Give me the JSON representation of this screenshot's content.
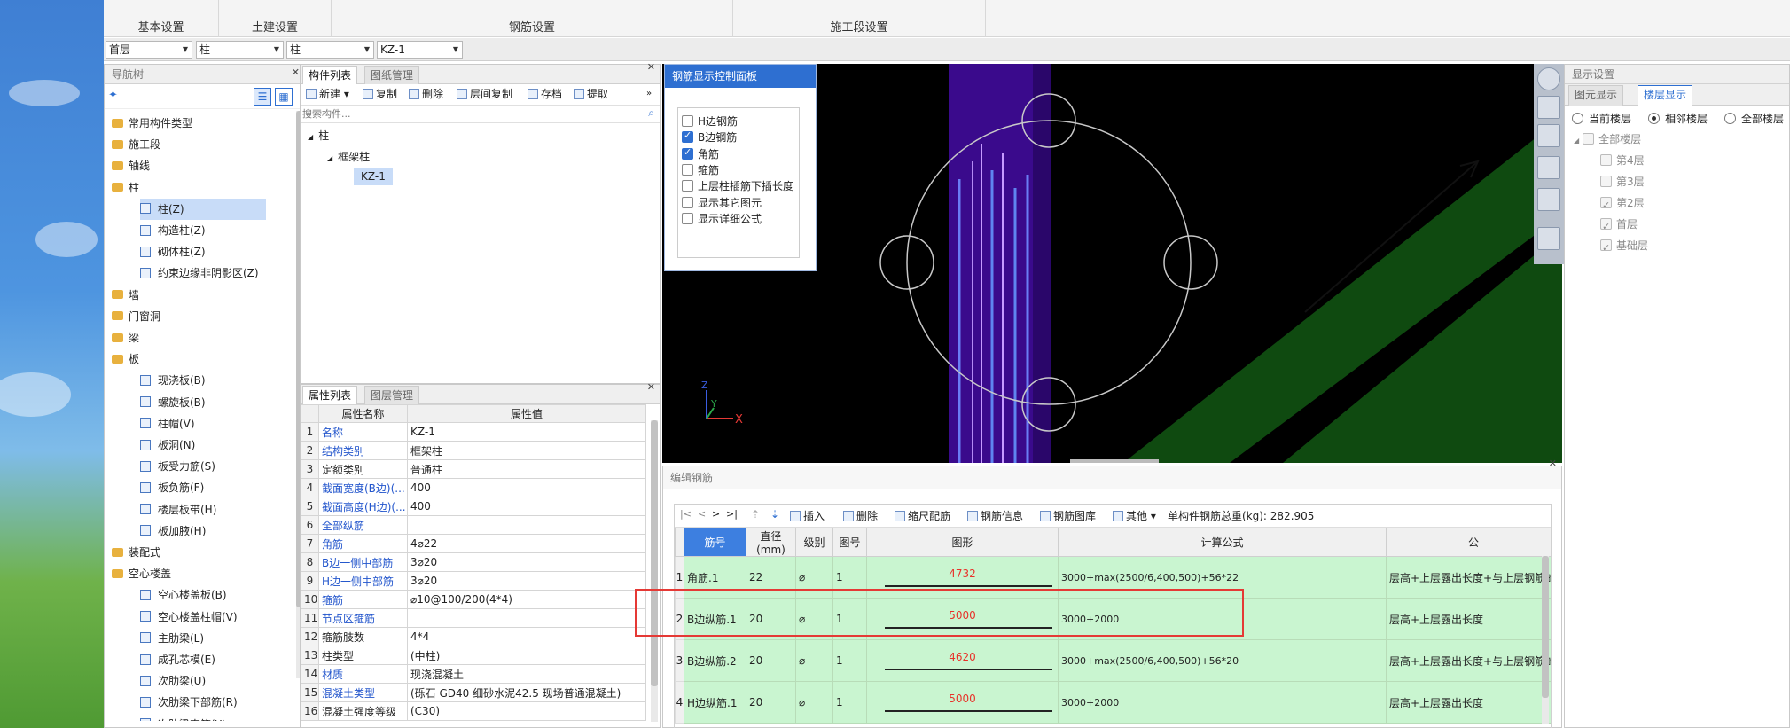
{
  "ribbon": {
    "groups": [
      "基本设置",
      "土建设置",
      "钢筋设置",
      "施工段设置"
    ]
  },
  "selectors": {
    "floor": "首层",
    "type1": "柱",
    "type2": "柱",
    "component": "KZ-1"
  },
  "nav": {
    "title": "导航树",
    "items": [
      {
        "label": "常用构件类型",
        "kind": "folder"
      },
      {
        "label": "施工段",
        "kind": "folder"
      },
      {
        "label": "轴线",
        "kind": "folder"
      },
      {
        "label": "柱",
        "kind": "folder"
      },
      {
        "label": "柱(Z)",
        "kind": "child",
        "selected": true
      },
      {
        "label": "构造柱(Z)",
        "kind": "child"
      },
      {
        "label": "砌体柱(Z)",
        "kind": "child"
      },
      {
        "label": "约束边缘非阴影区(Z)",
        "kind": "child"
      },
      {
        "label": "墙",
        "kind": "folder"
      },
      {
        "label": "门窗洞",
        "kind": "folder"
      },
      {
        "label": "梁",
        "kind": "folder"
      },
      {
        "label": "板",
        "kind": "folder"
      },
      {
        "label": "现浇板(B)",
        "kind": "child"
      },
      {
        "label": "螺旋板(B)",
        "kind": "child"
      },
      {
        "label": "柱帽(V)",
        "kind": "child"
      },
      {
        "label": "板洞(N)",
        "kind": "child"
      },
      {
        "label": "板受力筋(S)",
        "kind": "child"
      },
      {
        "label": "板负筋(F)",
        "kind": "child"
      },
      {
        "label": "楼层板带(H)",
        "kind": "child"
      },
      {
        "label": "板加腋(H)",
        "kind": "child"
      },
      {
        "label": "装配式",
        "kind": "folder"
      },
      {
        "label": "空心楼盖",
        "kind": "folder"
      },
      {
        "label": "空心楼盖板(B)",
        "kind": "child"
      },
      {
        "label": "空心楼盖柱帽(V)",
        "kind": "child"
      },
      {
        "label": "主肋梁(L)",
        "kind": "child"
      },
      {
        "label": "成孔芯模(E)",
        "kind": "child"
      },
      {
        "label": "次肋梁(U)",
        "kind": "child"
      },
      {
        "label": "次肋梁下部筋(R)",
        "kind": "child"
      },
      {
        "label": "次肋梁直筋(Y)",
        "kind": "child"
      }
    ]
  },
  "component_list": {
    "tabs": [
      "构件列表",
      "图纸管理"
    ],
    "toolbar": [
      "新建",
      "复制",
      "删除",
      "层间复制",
      "存档",
      "提取"
    ],
    "search_placeholder": "搜索构件...",
    "tree": [
      "柱",
      "框架柱",
      "KZ-1"
    ]
  },
  "properties": {
    "tabs": [
      "属性列表",
      "图层管理"
    ],
    "headers": [
      "属性名称",
      "属性值"
    ],
    "rows": [
      {
        "no": "1",
        "name": "名称",
        "value": "KZ-1"
      },
      {
        "no": "2",
        "name": "结构类别",
        "value": "框架柱"
      },
      {
        "no": "3",
        "name": "定额类别",
        "value": "普通柱"
      },
      {
        "no": "4",
        "name": "截面宽度(B边)(...",
        "value": "400"
      },
      {
        "no": "5",
        "name": "截面高度(H边)(...",
        "value": "400"
      },
      {
        "no": "6",
        "name": "全部纵筋",
        "value": ""
      },
      {
        "no": "7",
        "name": "角筋",
        "value": "4⌀22"
      },
      {
        "no": "8",
        "name": "B边一侧中部筋",
        "value": "3⌀20"
      },
      {
        "no": "9",
        "name": "H边一侧中部筋",
        "value": "3⌀20"
      },
      {
        "no": "10",
        "name": "箍筋",
        "value": "⌀10@100/200(4*4)"
      },
      {
        "no": "11",
        "name": "节点区箍筋",
        "value": ""
      },
      {
        "no": "12",
        "name": "箍筋肢数",
        "value": "4*4"
      },
      {
        "no": "13",
        "name": "柱类型",
        "value": "(中柱)"
      },
      {
        "no": "14",
        "name": "材质",
        "value": "现浇混凝土"
      },
      {
        "no": "15",
        "name": "混凝土类型",
        "value": "(砾石 GD40 细砂水泥42.5 现场普通混凝土)"
      },
      {
        "no": "16",
        "name": "混凝土强度等级",
        "value": "(C30)"
      }
    ]
  },
  "rebar_control": {
    "title": "钢筋显示控制面板",
    "options": [
      {
        "label": "H边钢筋",
        "checked": false
      },
      {
        "label": "B边钢筋",
        "checked": true
      },
      {
        "label": "角筋",
        "checked": true
      },
      {
        "label": "箍筋",
        "checked": false
      },
      {
        "label": "上层柱插筋下插长度",
        "checked": false
      },
      {
        "label": "显示其它图元",
        "checked": false
      },
      {
        "label": "显示详细公式",
        "checked": false
      }
    ]
  },
  "edit_rebar": {
    "title": "编辑钢筋",
    "toolbar": [
      "插入",
      "删除",
      "缩尺配筋",
      "钢筋信息",
      "钢筋图库",
      "其他"
    ],
    "total_label": "单构件钢筋总重(kg): 282.905",
    "headers": [
      "筋号",
      "直径(mm)",
      "级别",
      "图号",
      "图形",
      "计算公式",
      "公"
    ],
    "rows": [
      {
        "no": "1",
        "name": "角筋.1",
        "dia": "22",
        "grade": "⌀",
        "fig": "1",
        "shape": "4732",
        "formula": "3000+max(2500/6,400,500)+56*22",
        "desc": "层高+上层露出长度+与上层钢筋的搭"
      },
      {
        "no": "2",
        "name": "B边纵筋.1",
        "dia": "20",
        "grade": "⌀",
        "fig": "1",
        "shape": "5000",
        "formula": "3000+2000",
        "desc": "层高+上层露出长度"
      },
      {
        "no": "3",
        "name": "B边纵筋.2",
        "dia": "20",
        "grade": "⌀",
        "fig": "1",
        "shape": "4620",
        "formula": "3000+max(2500/6,400,500)+56*20",
        "desc": "层高+上层露出长度+与上层钢筋的搭"
      },
      {
        "no": "4",
        "name": "H边纵筋.1",
        "dia": "20",
        "grade": "⌀",
        "fig": "1",
        "shape": "5000",
        "formula": "3000+2000",
        "desc": "层高+上层露出长度"
      }
    ]
  },
  "display_settings": {
    "title": "显示设置",
    "tabs": [
      "图元显示",
      "楼层显示"
    ],
    "radios": [
      {
        "label": "当前楼层",
        "on": false
      },
      {
        "label": "相邻楼层",
        "on": true
      },
      {
        "label": "全部楼层",
        "on": false
      }
    ],
    "all_floors": "全部楼层",
    "floors": [
      {
        "label": "第4层",
        "checked": false
      },
      {
        "label": "第3层",
        "checked": false
      },
      {
        "label": "第2层",
        "checked": true
      },
      {
        "label": "首层",
        "checked": true
      },
      {
        "label": "基础层",
        "checked": true
      }
    ]
  },
  "viewport": {
    "axis_x": "X",
    "axis_y": "Y",
    "axis_z": "Z"
  },
  "colors": {
    "highlight_border": "#e53935",
    "row_green": "#c9f5d0",
    "accent_blue": "#2e6fd1"
  }
}
